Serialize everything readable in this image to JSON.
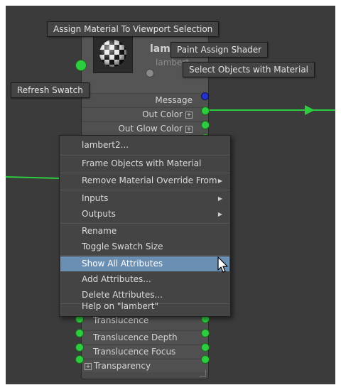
{
  "tooltips": {
    "assign_material": "Assign Material To Viewport Selection",
    "paint_assign": "Paint Assign Shader",
    "select_objects": "Select Objects with Material",
    "refresh_swatch": "Refresh Swatch"
  },
  "node": {
    "title": "lamb",
    "subtitle": "lambert",
    "top_attributes": [
      {
        "label": "Message",
        "port": "blue"
      },
      {
        "label": "Out Color",
        "port": "green",
        "expandable": true
      },
      {
        "label": "Out Glow Color",
        "port": "green",
        "expandable": true
      }
    ],
    "bottom_attributes": [
      {
        "label": "Translucence"
      },
      {
        "label": "Translucence Depth"
      },
      {
        "label": "Translucence Focus"
      },
      {
        "label": "Transparency",
        "expandable": true
      }
    ]
  },
  "context_menu": {
    "items": [
      {
        "label": "lambert2...",
        "submenu": false
      },
      {
        "label": "Frame Objects with Material",
        "submenu": false
      },
      {
        "label": "Remove Material Override From",
        "submenu": true
      },
      {
        "label": "Inputs",
        "submenu": true
      },
      {
        "label": "Outputs",
        "submenu": true
      },
      {
        "label": "Rename",
        "submenu": false
      },
      {
        "label": "Toggle Swatch Size",
        "submenu": false
      },
      {
        "label": "Show All Attributes",
        "submenu": false,
        "highlighted": true
      },
      {
        "label": "Add Attributes...",
        "submenu": false
      },
      {
        "label": "Delete Attributes...",
        "submenu": false
      },
      {
        "label": "Help on \"lambert\"",
        "submenu": false
      }
    ]
  },
  "colors": {
    "canvas": "#3b3b3b",
    "connection": "#2ecc40",
    "menu_highlight": "#6b8eb3"
  },
  "icons": {
    "submenu_arrow": "▶",
    "expander": "⊞"
  }
}
